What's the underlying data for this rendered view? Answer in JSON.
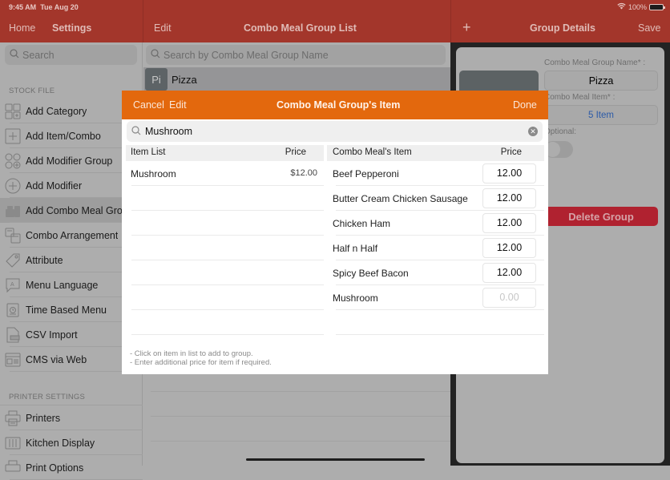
{
  "status_bar": {
    "time": "9:45 AM",
    "date": "Tue Aug 20",
    "battery": "100%"
  },
  "left_header": {
    "home": "Home",
    "settings": "Settings"
  },
  "left_search": {
    "placeholder": "Search"
  },
  "sections": {
    "stock_file": "STOCK FILE",
    "printer_settings": "PRINTER SETTINGS"
  },
  "stock_items": [
    {
      "label": "Add Category",
      "icon": "category-grid-icon"
    },
    {
      "label": "Add Item/Combo",
      "icon": "plus-square-icon"
    },
    {
      "label": "Add Modifier Group",
      "icon": "modifier-group-icon"
    },
    {
      "label": "Add Modifier",
      "icon": "plus-circle-icon"
    },
    {
      "label": "Add Combo Meal Group",
      "icon": "combo-meal-icon",
      "active": true
    },
    {
      "label": "Combo Arrangement",
      "icon": "arrangement-icon"
    },
    {
      "label": "Attribute",
      "icon": "tag-icon"
    },
    {
      "label": "Menu Language",
      "icon": "language-bubble-icon"
    },
    {
      "label": "Time Based Menu",
      "icon": "clock-menu-icon"
    },
    {
      "label": "CSV Import",
      "icon": "csv-file-icon"
    },
    {
      "label": "CMS via Web",
      "icon": "web-window-icon"
    }
  ],
  "printer_items": [
    {
      "label": "Printers",
      "icon": "printer-icon"
    },
    {
      "label": "Kitchen Display",
      "icon": "kitchen-display-icon"
    },
    {
      "label": "Print Options",
      "icon": "print-options-icon"
    }
  ],
  "middle": {
    "edit": "Edit",
    "title": "Combo Meal Group List",
    "search_placeholder": "Search by Combo Meal Group Name",
    "groups": [
      {
        "badge": "Pi",
        "name": "Pizza"
      }
    ]
  },
  "right": {
    "add": "+",
    "title": "Group Details",
    "save": "Save",
    "name_label": "Combo Meal Group Name* :",
    "name_value": "Pizza",
    "item_label": "Combo Meal Item* :",
    "item_value": "5 Item",
    "optional_label": "Optional:",
    "optional_on": false,
    "delete": "Delete Group"
  },
  "modal": {
    "cancel": "Cancel",
    "edit": "Edit",
    "title": "Combo Meal Group's Item",
    "done": "Done",
    "search_value": "Mushroom",
    "left_header": {
      "name": "Item List",
      "price": "Price"
    },
    "right_header": {
      "name": "Combo Meal's Item",
      "price": "Price"
    },
    "item_list": [
      {
        "name": "Mushroom",
        "price": "$12.00"
      }
    ],
    "combo_items": [
      {
        "name": "Beef Pepperoni",
        "price": "12.00",
        "placeholder": ""
      },
      {
        "name": "Butter Cream Chicken Sausage",
        "price": "12.00",
        "placeholder": ""
      },
      {
        "name": "Chicken Ham",
        "price": "12.00",
        "placeholder": ""
      },
      {
        "name": "Half n Half",
        "price": "12.00",
        "placeholder": ""
      },
      {
        "name": "Spicy Beef Bacon",
        "price": "12.00",
        "placeholder": ""
      },
      {
        "name": "Mushroom",
        "price": "",
        "placeholder": "0.00"
      }
    ],
    "hints": [
      "- Click on item in list to add to group.",
      "- Enter additional price for item if required."
    ]
  },
  "colors": {
    "header_red": "#a3362b",
    "modal_orange": "#e3680d",
    "delete_red": "#b02230",
    "link_blue": "#2f6fd6"
  }
}
